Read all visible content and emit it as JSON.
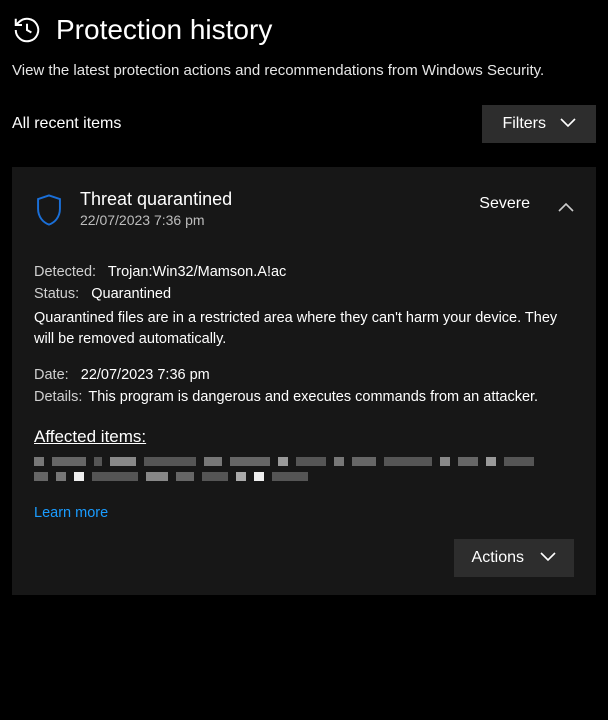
{
  "header": {
    "title": "Protection history",
    "subtitle": "View the latest protection actions and recommendations from Windows Security."
  },
  "toolbar": {
    "all_recent": "All recent items",
    "filters_label": "Filters"
  },
  "threat": {
    "title": "Threat quarantined",
    "timestamp": "22/07/2023 7:36 pm",
    "severity": "Severe",
    "detected_label": "Detected:",
    "detected_value": "Trojan:Win32/Mamson.A!ac",
    "status_label": "Status:",
    "status_value": "Quarantined",
    "status_description": "Quarantined files are in a restricted area where they can't harm your device. They will be removed automatically.",
    "date_label": "Date:",
    "date_value": "22/07/2023 7:36 pm",
    "details_label": "Details:",
    "details_value": "This program is dangerous and executes commands from an attacker.",
    "affected_title": "Affected items:",
    "learn_more": "Learn more",
    "actions_label": "Actions"
  }
}
